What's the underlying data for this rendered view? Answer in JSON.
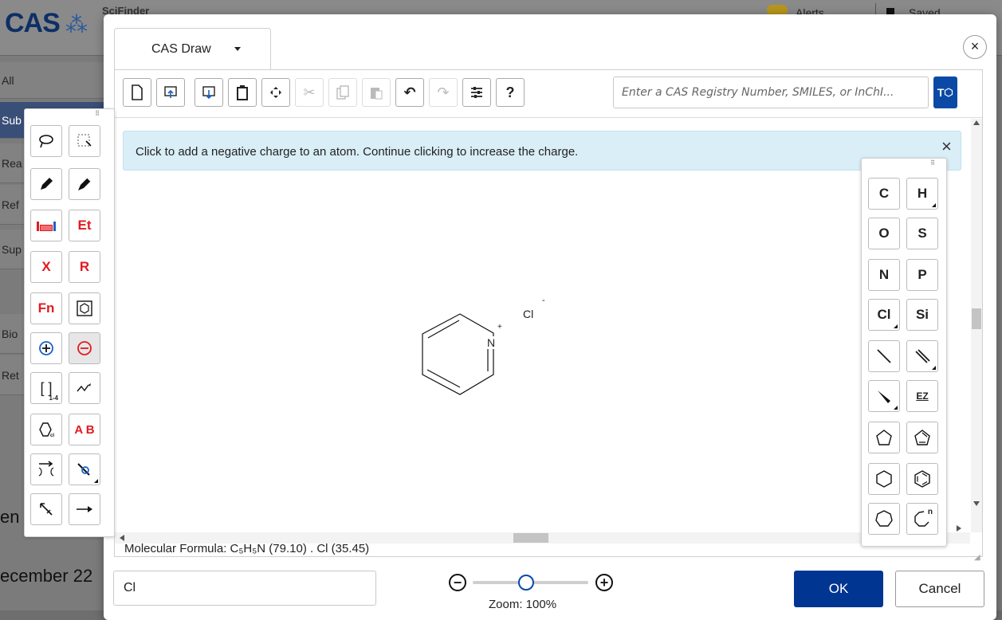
{
  "background": {
    "logo": "CAS",
    "app_name": "SciFinder",
    "alerts_label": "Alerts",
    "saved_label": "Saved",
    "side_items": [
      "All",
      "Sub",
      "Rea",
      "Ref",
      "Sup",
      "Bio",
      "Ret"
    ],
    "section_heading": "en",
    "date_text": "ecember 22"
  },
  "dialog": {
    "tab_label": "CAS Draw",
    "close_label": "×",
    "toolbar": {
      "help_label": "?",
      "search_placeholder": "Enter a CAS Registry Number, SMILES, or InChI...",
      "search_button_label": "T"
    },
    "info_message": "Click to add a negative charge to an atom. Continue clicking to increase the charge.",
    "info_close_label": "×",
    "molecule": {
      "atom_n": "N",
      "charge_plus": "+",
      "atom_cl": "Cl",
      "charge_minus": "-"
    },
    "formula_label": "Molecular Formula: C₅H₅N (79.10) . Cl (35.45)",
    "left_palette": [
      {
        "label": "",
        "icon": "lasso-icon"
      },
      {
        "label": "",
        "icon": "marquee-select-icon"
      },
      {
        "label": "",
        "icon": "pencil-icon"
      },
      {
        "label": "",
        "icon": "eraser-icon"
      },
      {
        "label": "",
        "icon": "periodic-table-icon"
      },
      {
        "label": "Et",
        "icon": "shortcut-icon"
      },
      {
        "label": "X",
        "icon": "x-variable-icon"
      },
      {
        "label": "R",
        "icon": "r-group-icon"
      },
      {
        "label": "Fn",
        "icon": "function-group-icon"
      },
      {
        "label": "",
        "icon": "ring-template-icon"
      },
      {
        "label": "",
        "icon": "positive-charge-icon"
      },
      {
        "label": "",
        "icon": "negative-charge-icon"
      },
      {
        "label": "1-4",
        "icon": "repeating-group-icon"
      },
      {
        "label": "",
        "icon": "chain-icon"
      },
      {
        "label": "",
        "icon": "ring-attach-icon"
      },
      {
        "label": "A B",
        "icon": "reaction-arrow-ab-icon"
      },
      {
        "label": "",
        "icon": "atom-mapping-icon"
      },
      {
        "label": "",
        "icon": "bond-lock-icon"
      },
      {
        "label": "",
        "icon": "cleave-bond-icon"
      },
      {
        "label": "",
        "icon": "reaction-arrow-icon"
      }
    ],
    "right_palette": [
      {
        "label": "C"
      },
      {
        "label": "H"
      },
      {
        "label": "O"
      },
      {
        "label": "S"
      },
      {
        "label": "N"
      },
      {
        "label": "P"
      },
      {
        "label": "Cl"
      },
      {
        "label": "Si"
      },
      {
        "label": "",
        "icon": "single-bond-icon"
      },
      {
        "label": "",
        "icon": "double-bond-icon"
      },
      {
        "label": "",
        "icon": "wedge-bond-icon"
      },
      {
        "label": "EZ",
        "icon": "ez-bond-icon"
      },
      {
        "label": "",
        "icon": "cyclopentane-icon"
      },
      {
        "label": "",
        "icon": "cyclopentadiene-icon"
      },
      {
        "label": "",
        "icon": "cyclohexane-icon"
      },
      {
        "label": "",
        "icon": "benzene-icon"
      },
      {
        "label": "",
        "icon": "cycloheptane-icon"
      },
      {
        "label": "n",
        "icon": "ring-size-n-icon"
      }
    ],
    "name_input_value": "Cl",
    "zoom_label": "Zoom: 100%",
    "zoom_level_percent": 100,
    "ok_label": "OK",
    "cancel_label": "Cancel"
  },
  "colors": {
    "primary_blue": "#003591",
    "accent_red": "#e21a22",
    "info_bar": "#d9eef7"
  }
}
